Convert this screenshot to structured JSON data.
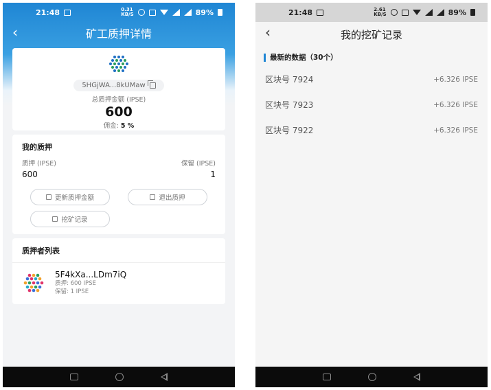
{
  "left": {
    "status": {
      "time": "21:48",
      "speed": "0.31\nKB/S",
      "battery": "89%"
    },
    "title": "矿工质押详情",
    "address": "5HGjWA...8kUMaw",
    "total_label": "总质押金额 (IPSE)",
    "total_value": "600",
    "commission_label": "佣金:",
    "commission_value": "5 %",
    "pledge": {
      "title": "我的质押",
      "pledge_label": "质押 (IPSE)",
      "reserve_label": "保留 (IPSE)",
      "pledge_value": "600",
      "reserve_value": "1",
      "btn_update": "更新质押金额",
      "btn_exit": "退出质押",
      "btn_records": "挖矿记录"
    },
    "list": {
      "title": "质押者列表",
      "items": [
        {
          "name": "5F4kXa...LDm7iQ",
          "pledge": "质押: 600 IPSE",
          "reserve": "保留: 1 IPSE"
        }
      ]
    }
  },
  "right": {
    "status": {
      "time": "21:48",
      "speed": "2.61\nKB/S",
      "battery": "89%"
    },
    "title": "我的挖矿记录",
    "section_title": "最新的数据（30个）",
    "records": [
      {
        "block": "区块号 7924",
        "amount": "+6.326 IPSE"
      },
      {
        "block": "区块号 7923",
        "amount": "+6.326 IPSE"
      },
      {
        "block": "区块号 7922",
        "amount": "+6.326 IPSE"
      }
    ]
  },
  "colors": {
    "accent": "#1f86d4",
    "header_gradient_end": "#3aa0e2"
  }
}
